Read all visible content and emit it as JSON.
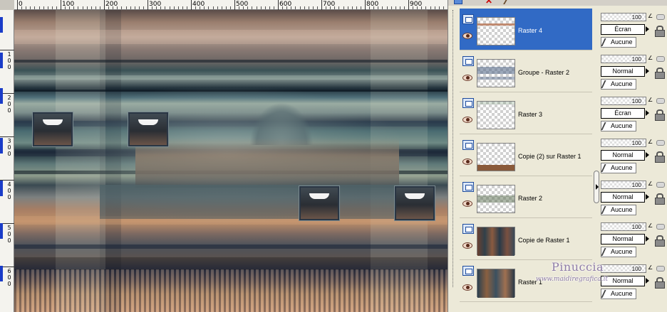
{
  "ruler": {
    "top_labels": [
      "0",
      "100",
      "200",
      "300",
      "400",
      "500",
      "600",
      "700",
      "800",
      "900"
    ],
    "left_labels": [
      "1\n0\n0",
      "2\n0\n0",
      "3\n0\n0",
      "4\n0\n0",
      "5\n0\n0",
      "6\n0\n0"
    ]
  },
  "layers": [
    {
      "name": "Raster 4",
      "selected": true,
      "opacity": "100",
      "blend": "Écran",
      "mask": "Aucune"
    },
    {
      "name": "Groupe - Raster 2",
      "selected": false,
      "opacity": "100",
      "blend": "Normal",
      "mask": "Aucune"
    },
    {
      "name": "Raster 3",
      "selected": false,
      "opacity": "100",
      "blend": "Écran",
      "mask": "Aucune"
    },
    {
      "name": "Copie (2) sur Raster 1",
      "selected": false,
      "opacity": "100",
      "blend": "Normal",
      "mask": "Aucune"
    },
    {
      "name": "Raster 2",
      "selected": false,
      "opacity": "100",
      "blend": "Normal",
      "mask": "Aucune"
    },
    {
      "name": "Copie de Raster 1",
      "selected": false,
      "opacity": "100",
      "blend": "Normal",
      "mask": "Aucune"
    },
    {
      "name": "Raster 1",
      "selected": false,
      "opacity": "100",
      "blend": "Normal",
      "mask": "Aucune"
    }
  ],
  "watermark": {
    "title": "Pinuccia",
    "url": "www.maidiregrafica.it"
  },
  "colors": {
    "selection": "#316ac5",
    "panel_bg": "#ece9d8",
    "watermark": "#8e7ca6"
  }
}
